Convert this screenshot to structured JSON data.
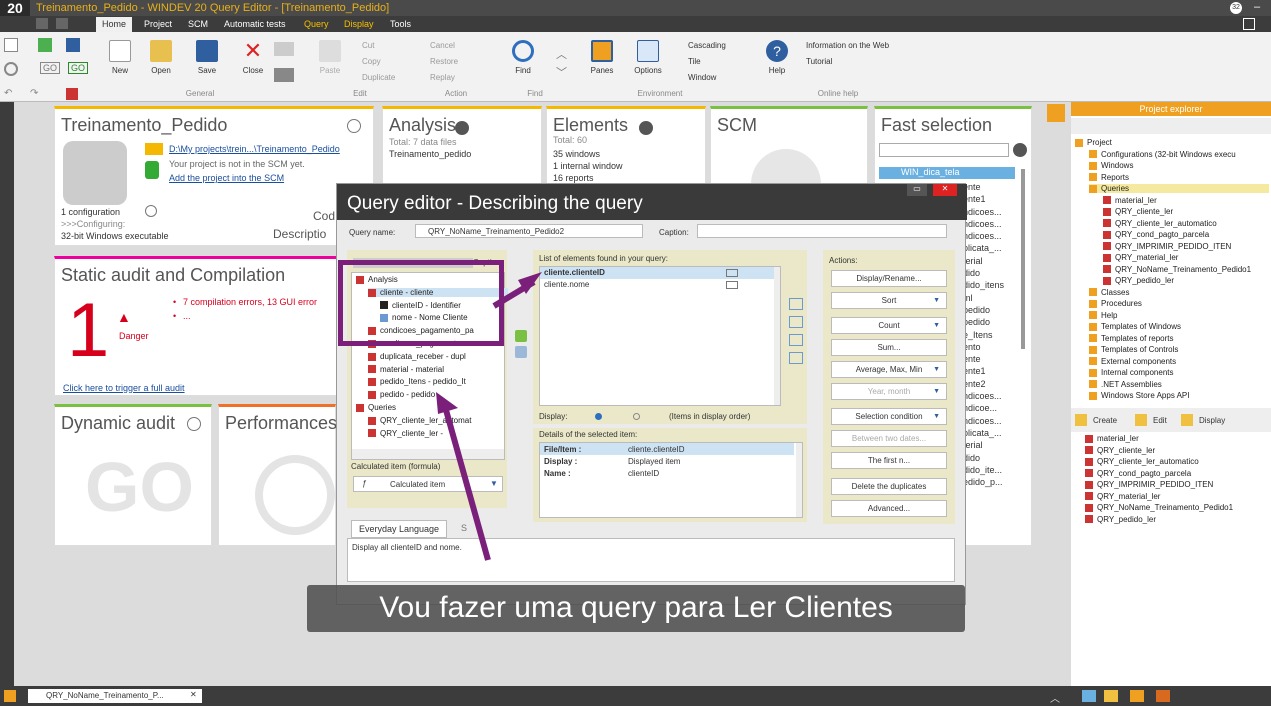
{
  "window": {
    "logo": "20",
    "title": "Treinamento_Pedido - WINDEV 20  Query Editor - [Treinamento_Pedido]",
    "badge": "32"
  },
  "menu": {
    "tabs": [
      "Home",
      "Project",
      "SCM",
      "Automatic tests",
      "Query",
      "Display",
      "Tools"
    ]
  },
  "ribbon": {
    "buttons": {
      "new": "New",
      "open": "Open",
      "save": "Save",
      "close": "Close",
      "paste": "Paste",
      "find": "Find",
      "panes": "Panes",
      "options": "Options",
      "help": "Help"
    },
    "small": {
      "cut": "Cut",
      "copy": "Copy",
      "duplicate": "Duplicate",
      "cancel": "Cancel",
      "restore": "Restore",
      "replay": "Replay",
      "cascading": "Cascading",
      "tile": "Tile",
      "window": "Window",
      "info_web": "Information on the Web",
      "tutorial": "Tutorial"
    },
    "groups": {
      "general": "General",
      "edit": "Edit",
      "action": "Action",
      "find": "Find",
      "environment": "Environment",
      "online_help": "Online help"
    }
  },
  "dashboard": {
    "project": {
      "title": "Treinamento_Pedido",
      "path": "D:\\My projects\\trein...\\Treinamento_Pedido",
      "scm_note": "Your project is not in the SCM yet.",
      "scm_link": "Add the project into the SCM",
      "config": "1 configuration",
      "configuring": ">>>Configuring:",
      "exe": "32-bit Windows executable",
      "code_label": "Cod",
      "desc_label": "Descriptio"
    },
    "analysis": {
      "title": "Analysis",
      "total": "Total: 7 data files",
      "name": "Treinamento_pedido"
    },
    "elements": {
      "title": "Elements",
      "total": "Total: 60",
      "windows": "35 windows",
      "internal": "1 internal window",
      "reports": "16 reports"
    },
    "scm": {
      "title": "SCM"
    },
    "fast": {
      "title": "Fast selection",
      "selected": "WIN_dica_tela",
      "items": [
        "ente",
        "ente1",
        "ndicoes...",
        "ndicoes...",
        "ndicoes...",
        "plicata_...",
        "terial",
        "dido",
        "dido_itens",
        "ml",
        "pedido",
        "pedido",
        "e_Itens",
        "ento",
        "ente",
        "ente1",
        "ente2",
        "ndicoes...",
        "ndicoe...",
        "ndicoes...",
        "plicata_...",
        "terial",
        "dido",
        "dido_ite...",
        "edido_p..."
      ]
    },
    "audit": {
      "title": "Static audit and Compilation",
      "count": "1",
      "danger": "Danger",
      "errors": "7 compilation errors, 13 GUI error",
      "more": "...",
      "link": "Click here to trigger a full audit"
    },
    "dynamic": {
      "title": "Dynamic audit"
    },
    "performances": {
      "title": "Performances"
    }
  },
  "explorer": {
    "title": "Project explorer",
    "tree": [
      "Project",
      "Configurations (32-bit Windows execu",
      "Windows",
      "Reports",
      "Queries",
      "material_ler",
      "QRY_cliente_ler",
      "QRY_cliente_ler_automatico",
      "QRY_cond_pagto_parcela",
      "QRY_IMPRIMIR_PEDIDO_ITEN",
      "QRY_material_ler",
      "QRY_NoName_Treinamento_Pedido1",
      "QRY_pedido_ler",
      "Classes",
      "Procedures",
      "Help",
      "Templates of Windows",
      "Templates of reports",
      "Templates of Controls",
      "External components",
      "Internal components",
      ".NET Assemblies",
      "Windows Store Apps API"
    ],
    "actions": {
      "create": "Create",
      "edit": "Edit",
      "display": "Display"
    },
    "list": [
      "material_ler",
      "QRY_cliente_ler",
      "QRY_cliente_ler_automatico",
      "QRY_cond_pagto_parcela",
      "QRY_IMPRIMIR_PEDIDO_ITEN",
      "QRY_material_ler",
      "QRY_NoName_Treinamento_Pedido1",
      "QRY_pedido_ler"
    ]
  },
  "dialog": {
    "title": "Query editor - Describing the query",
    "query_name_label": "Query name:",
    "query_name": "QRY_NoName_Treinamento_Pedido2",
    "caption_label": "Caption:",
    "tree_caption": "Captio",
    "tree": [
      "Analysis",
      "cliente - cliente",
      "clienteID - Identifier",
      "nome - Nome Cliente",
      "condicoes_pagamento_pa",
      "condicoes_pagamento",
      "duplicata_receber - dupl",
      "material - material",
      "pedido_Itens - pedido_It",
      "pedido - pedido",
      "Queries",
      "QRY_cliente_ler_automat",
      "QRY_cliente_ler -"
    ],
    "calc_label": "Calculated item (formula)",
    "calc_button": "Calculated item",
    "list_label": "List of elements found in your query:",
    "list_items": [
      "cliente.clienteID",
      "cliente.nome"
    ],
    "display_label": "Display:",
    "display_order": "(Items in display order)",
    "details_label": "Details of the selected item:",
    "details": [
      [
        "File/Item :",
        "cliente.clienteID"
      ],
      [
        "Display :",
        "Displayed item"
      ],
      [
        "Name :",
        "clienteID"
      ]
    ],
    "actions_label": "Actions:",
    "actions": [
      "Display/Rename...",
      "Sort",
      "Count",
      "Sum...",
      "Average, Max, Min",
      "Year, month",
      "Selection condition",
      "Between two dates...",
      "The first n...",
      "Delete the duplicates",
      "Advanced..."
    ],
    "lang_tab": "Everyday Language",
    "sql_tab": "S",
    "description": "Display all clienteID and nome."
  },
  "subtitle": "Vou fazer uma query para Ler Clientes",
  "status": {
    "tab": "QRY_NoName_Treinamento_P..."
  },
  "colors": {
    "accent": "#f5b800",
    "annotation": "#7a1f7a",
    "titlebar": "#3c3c3c",
    "explorer": "#f0a020"
  }
}
